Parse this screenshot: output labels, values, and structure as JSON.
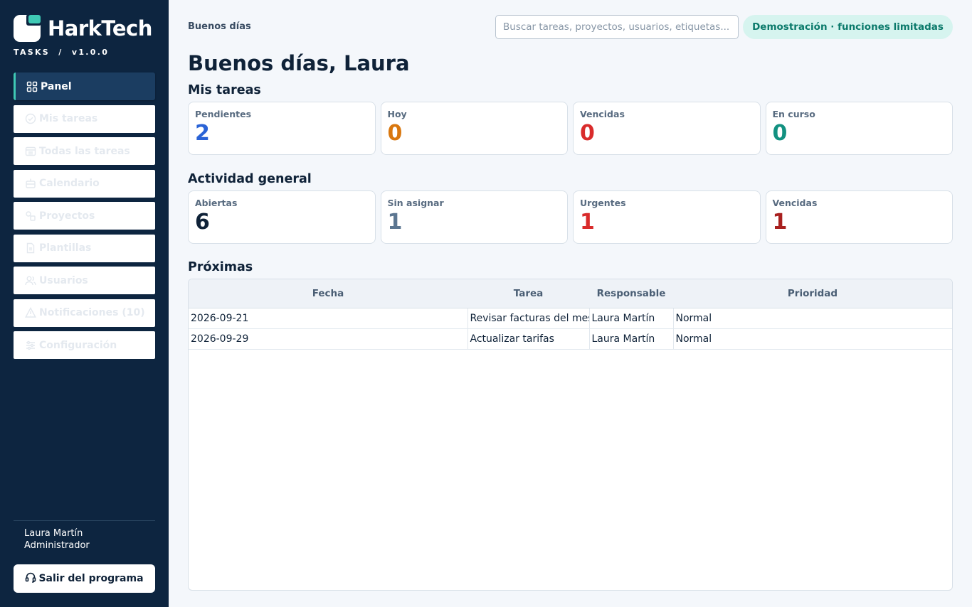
{
  "brand": {
    "name": "HarkTech",
    "subtitle": "TASKS  /  v1.0.0",
    "accent": "#3fc9b5"
  },
  "sidebar": {
    "items": [
      {
        "label": "Panel",
        "icon": "grid-icon",
        "active": true
      },
      {
        "label": "Mis tareas",
        "icon": "check-circle-icon"
      },
      {
        "label": "Todas las tareas",
        "icon": "table-icon"
      },
      {
        "label": "Calendario",
        "icon": "calendar-icon"
      },
      {
        "label": "Proyectos",
        "icon": "projects-icon"
      },
      {
        "label": "Plantillas",
        "icon": "document-icon"
      },
      {
        "label": "Usuarios",
        "icon": "users-icon"
      },
      {
        "label": "Notificaciones  (10)",
        "icon": "alert-icon"
      },
      {
        "label": "Configuración",
        "icon": "sliders-icon"
      }
    ],
    "user": {
      "name": "Laura Martín",
      "role": "Administrador"
    },
    "exit_label": "Salir del programa"
  },
  "header": {
    "greeting_small": "Buenos días",
    "search_placeholder": "Buscar tareas, proyectos, usuarios, etiquetas...",
    "demo_badge": "Demostración · funciones limitadas"
  },
  "main": {
    "title": "Buenos días, Laura",
    "my_tasks": {
      "title": "Mis tareas",
      "cards": [
        {
          "label": "Pendientes",
          "value": "2",
          "color": "#2a63d6"
        },
        {
          "label": "Hoy",
          "value": "0",
          "color": "#d9770e"
        },
        {
          "label": "Vencidas",
          "value": "0",
          "color": "#d92b2b"
        },
        {
          "label": "En curso",
          "value": "0",
          "color": "#129181"
        }
      ]
    },
    "activity": {
      "title": "Actividad general",
      "cards": [
        {
          "label": "Abiertas",
          "value": "6",
          "color": "#0f2238"
        },
        {
          "label": "Sin asignar",
          "value": "1",
          "color": "#5c7691"
        },
        {
          "label": "Urgentes",
          "value": "1",
          "color": "#d92b2b"
        },
        {
          "label": "Vencidas",
          "value": "1",
          "color": "#a8201f"
        }
      ]
    },
    "upcoming": {
      "title": "Próximas",
      "columns": [
        "Fecha",
        "Tarea",
        "Responsable",
        "Prioridad"
      ],
      "rows": [
        [
          "2026-09-21",
          "Revisar facturas del mes",
          "Laura Martín",
          "Normal"
        ],
        [
          "2026-09-29",
          "Actualizar tarifas",
          "Laura Martín",
          "Normal"
        ]
      ]
    }
  }
}
